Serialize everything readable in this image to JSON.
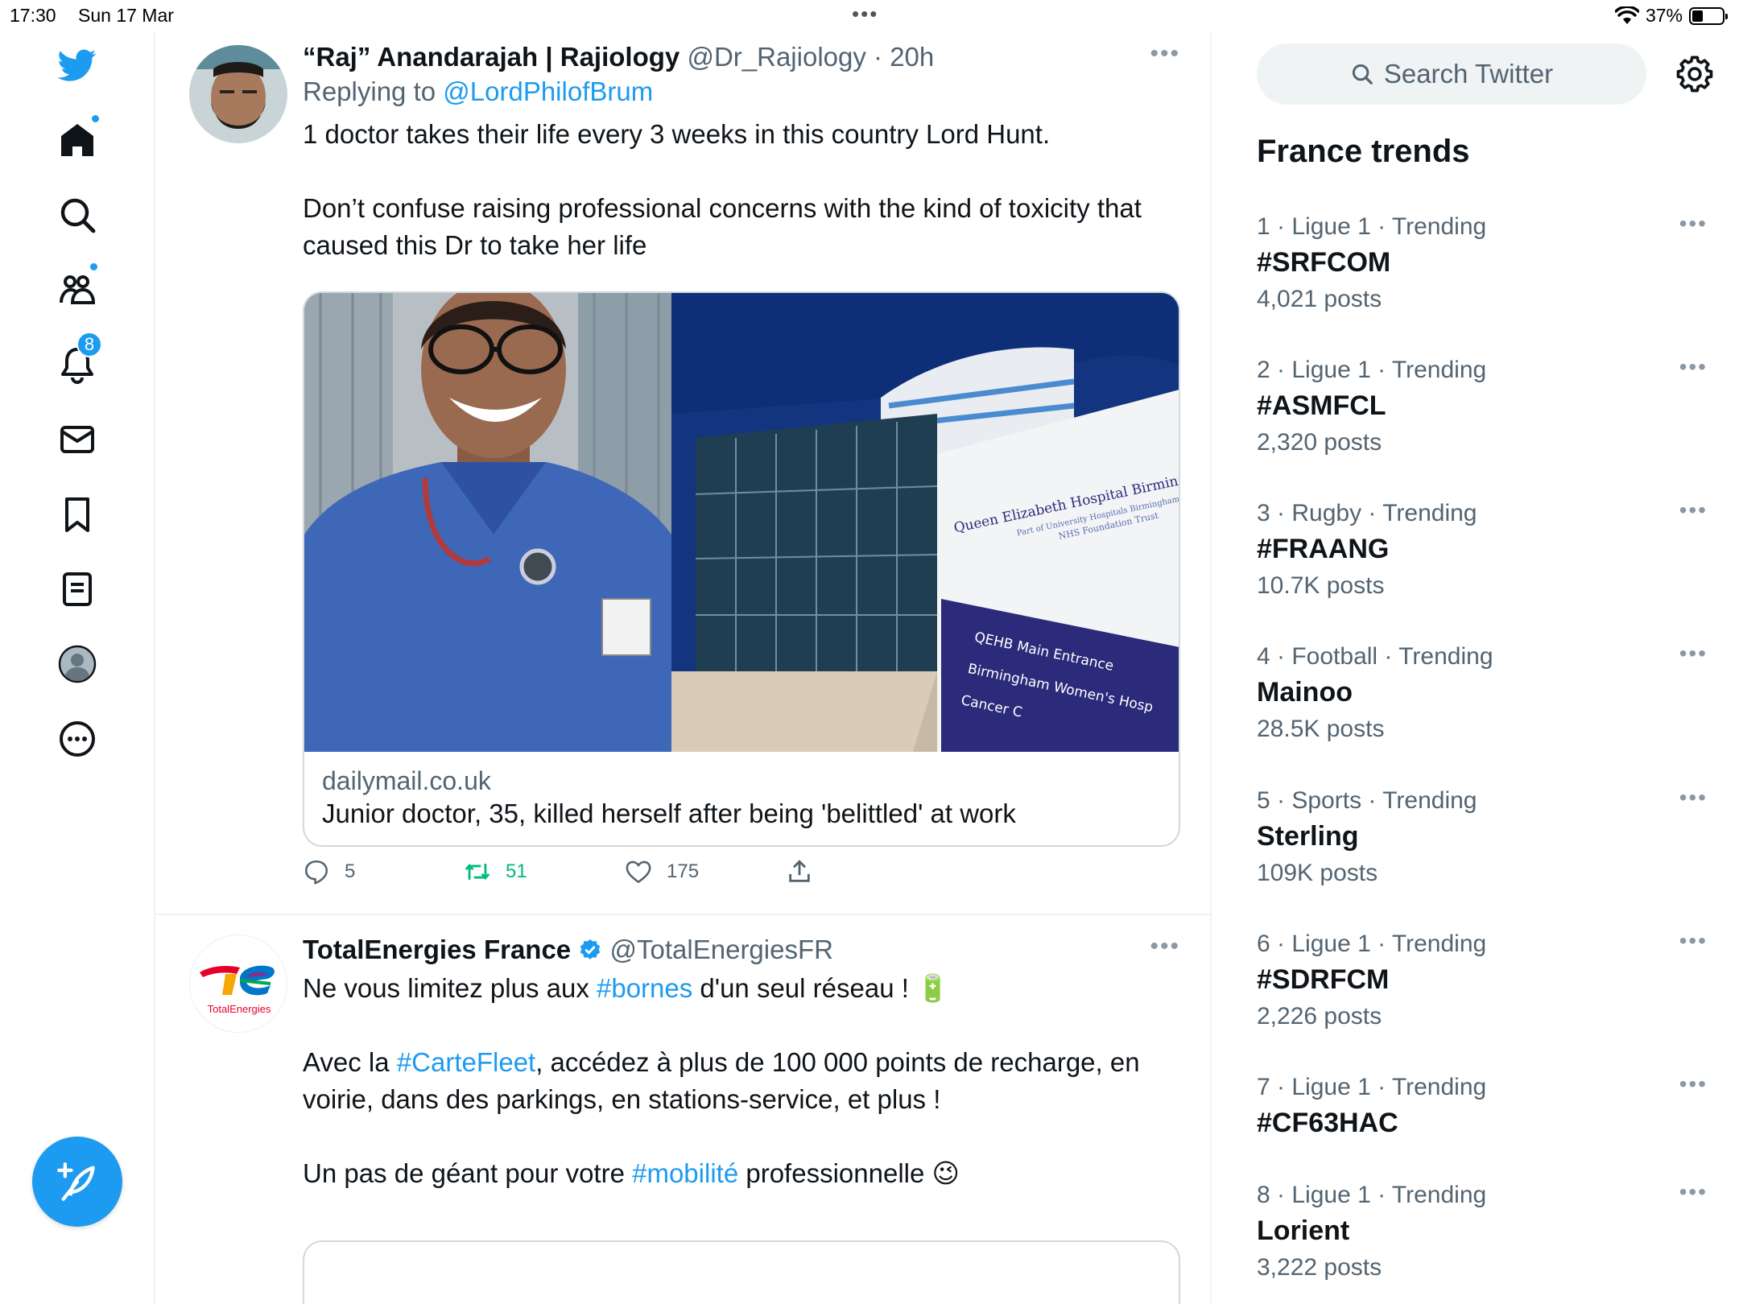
{
  "status": {
    "time": "17:30",
    "date": "Sun 17 Mar",
    "battery": "37%",
    "multitask_dots": "•••"
  },
  "nav": {
    "notifications_badge": "8"
  },
  "tweets": [
    {
      "name": "“Raj” Anandarajah | Rajiology",
      "handle": "@Dr_Rajiology",
      "sep": " · ",
      "time": "20h",
      "more": "•••",
      "reply_prefix": "Replying to ",
      "reply_to": "@LordPhilofBrum",
      "text_1": "1 doctor takes their life every 3 weeks in this country Lord Hunt.",
      "text_2": "Don’t confuse raising professional concerns with the kind of toxicity that caused this Dr to take her life",
      "card": {
        "domain": "dailymail.co.uk",
        "title": "Junior doctor, 35, killed herself after being 'belittled' at work",
        "sign_line1": "Queen Elizabeth Hospital Birmingham",
        "sign_line2": "Part of University Hospitals Birmingham",
        "sign_line3": "NHS Foundation Trust",
        "sign_dir1": "QEHB Main Entrance",
        "sign_dir2": "Birmingham Women's Hosp",
        "sign_dir3": "Cancer C"
      },
      "replies": "5",
      "retweets": "51",
      "likes": "175"
    },
    {
      "name": "TotalEnergies France",
      "handle": "@TotalEnergiesFR",
      "more": "•••",
      "logo_text": "TotalEnergies",
      "line1_a": "Ne vous limitez plus aux ",
      "line1_tag": "#bornes",
      "line1_b": " d'un seul réseau ! 🔋",
      "line2_a": "Avec la ",
      "line2_tag": "#CarteFleet",
      "line2_b": ", accédez à plus de 100 000 points de recharge, en voirie, dans des parkings, en stations-service, et plus !",
      "line3_a": "Un pas de géant pour votre ",
      "line3_tag": "#mobilité",
      "line3_b": " professionnelle 😉"
    }
  ],
  "search": {
    "placeholder": "Search Twitter"
  },
  "trends_title": "France trends",
  "trends": [
    {
      "rank": "1",
      "category": "Ligue 1",
      "label": "Trending",
      "name": "#SRFCOM",
      "count": "4,021 posts"
    },
    {
      "rank": "2",
      "category": "Ligue 1",
      "label": "Trending",
      "name": "#ASMFCL",
      "count": "2,320 posts"
    },
    {
      "rank": "3",
      "category": "Rugby",
      "label": "Trending",
      "name": "#FRAANG",
      "count": "10.7K posts"
    },
    {
      "rank": "4",
      "category": "Football",
      "label": "Trending",
      "name": "Mainoo",
      "count": "28.5K posts"
    },
    {
      "rank": "5",
      "category": "Sports",
      "label": "Trending",
      "name": "Sterling",
      "count": "109K posts"
    },
    {
      "rank": "6",
      "category": "Ligue 1",
      "label": "Trending",
      "name": "#SDRFCM",
      "count": "2,226 posts"
    },
    {
      "rank": "7",
      "category": "Ligue 1",
      "label": "Trending",
      "name": "#CF63HAC",
      "count": ""
    },
    {
      "rank": "8",
      "category": "Ligue 1",
      "label": "Trending",
      "name": "Lorient",
      "count": "3,222 posts"
    }
  ],
  "colors": {
    "accent": "#1d9bf0",
    "retweet": "#00ba7c",
    "text": "#0f1419",
    "muted": "#536471"
  }
}
